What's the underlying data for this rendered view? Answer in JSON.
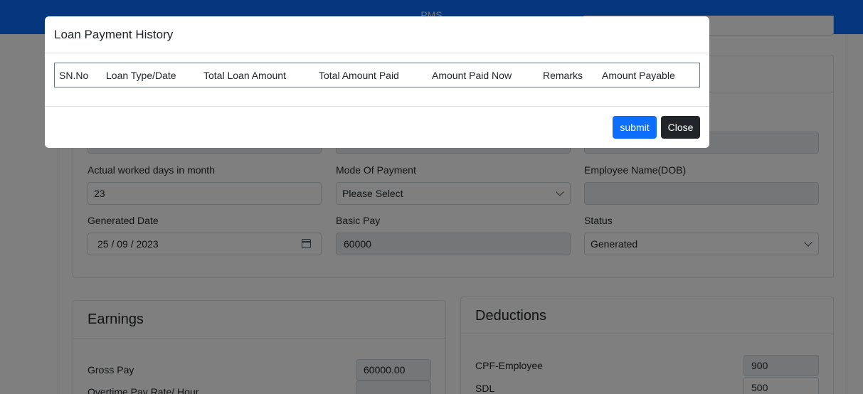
{
  "header": {
    "app_title": "PMS"
  },
  "payroll": {
    "worked_days_label": "Actual worked days in month",
    "worked_days_value": "23",
    "mode_of_payment_label": "Mode Of Payment",
    "mode_of_payment_value": "Please Select",
    "employee_name_label": "Employee Name(DOB)",
    "employee_name_value": "",
    "generated_date_label": "Generated Date",
    "generated_date_value": "25 / 09 / 2023",
    "basic_pay_label": "Basic Pay",
    "basic_pay_value": "60000",
    "status_label": "Status",
    "status_value": "Generated"
  },
  "earnings": {
    "title": "Earnings",
    "gross_pay_label": "Gross Pay",
    "gross_pay_value": "60000.00",
    "overtime_label": "Overtime Pay Rate/ Hour",
    "overtime_value": ""
  },
  "deductions": {
    "title": "Deductions",
    "cpf_label": "CPF-Employee",
    "cpf_value": "900",
    "sdl_label": "SDL",
    "sdl_value": "500"
  },
  "modal": {
    "title": "Loan Payment History",
    "columns": [
      "SN.No",
      "Loan Type/Date",
      "Total Loan Amount",
      "Total Amount Paid",
      "Amount Paid Now",
      "Remarks",
      "Amount Payable"
    ],
    "submit_label": "submit",
    "close_label": "Close"
  },
  "colors": {
    "primary": "#0d6efd",
    "dark": "#212529",
    "backdrop": "rgba(0,0,0,0.5)"
  }
}
